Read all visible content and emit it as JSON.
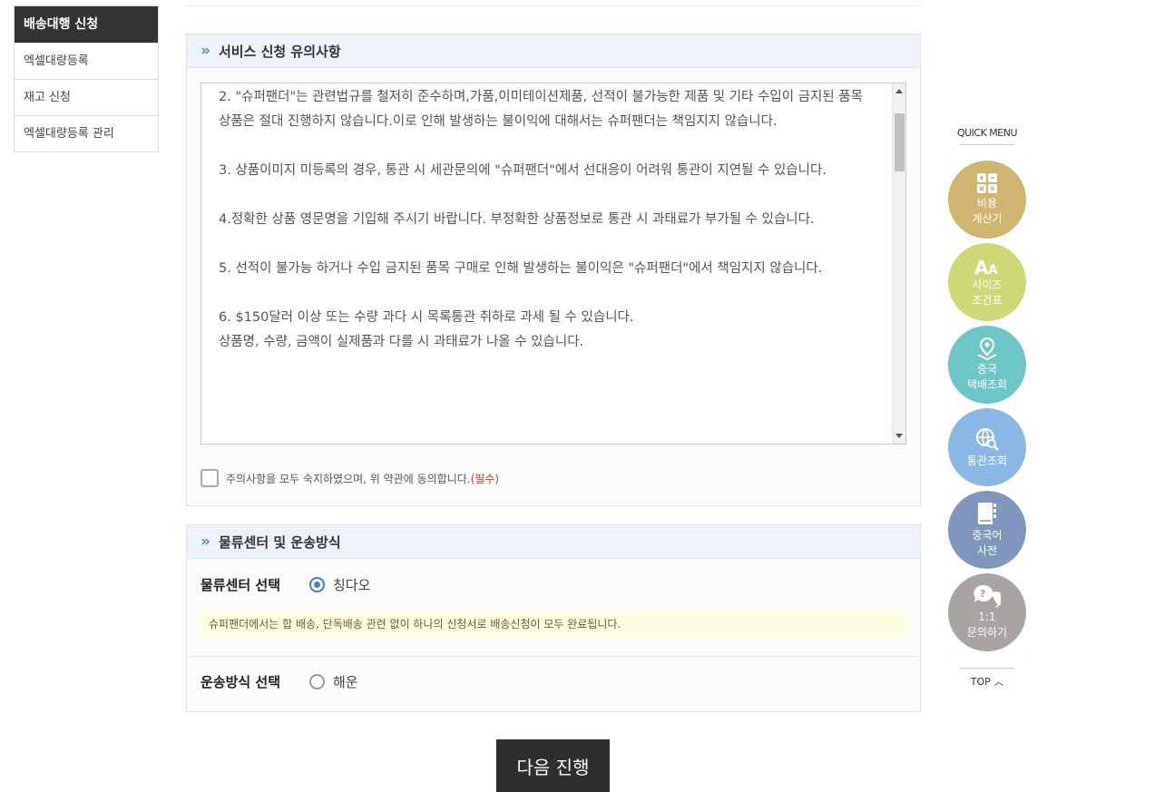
{
  "sidebar": {
    "header": "배송대행 신청",
    "items": [
      {
        "label": "엑셀대량등록"
      },
      {
        "label": "재고 신청"
      },
      {
        "label": "엑셀대량등록 관리"
      }
    ]
  },
  "notice": {
    "title": "서비스 신청 유의사항",
    "paragraphs": [
      "2. \"슈퍼팬더\"는 관련법규를 철저히 준수하며,가품,이미테이션제품, 선적이 불가능한 제품 및 기타 수입이 금지된 품목 상품은 절대 진행하지 않습니다.이로 인해 발생하는 불이익에 대해서는 슈퍼팬더는 책임지지 않습니다.",
      "3. 상품이미지 미등록의 경우, 통관 시 세관문의에 \"슈퍼팬더\"에서 선대응이 어려워 통관이 지연될 수 있습니다.",
      "4.정확한 상품 영문명을 기입해 주시기 바랍니다. 부정확한 상품정보로 통관 시 과태료가 부가될 수 있습니다.",
      "5. 선적이 불가능 하거나 수입 금지된 품목 구매로 인해 발생하는 불이익은 \"슈퍼팬더\"에서 책임지지 않습니다.",
      "6. $150달러 이상 또는 수량 과다 시 목록통관 취하로 과세 될 수 있습니다.\n상품명, 수량, 금액이 실제품과 다를 시 과태료가 나올 수 있습니다."
    ],
    "agree_text": "주의사항을 모두 숙지하였으며, 위 약관에 동의합니다.",
    "agree_required": "(필수)"
  },
  "logistics": {
    "title": "물류센터 및 운송방식",
    "center_label": "물류센터 선택",
    "center_option": "칭다오",
    "info": "슈퍼팬더에서는 합 배송, 단독배송 관련 없이 하나의 신청서로 배송신청이 모두 완료됩니다.",
    "shipping_label": "운송방식 선택",
    "shipping_option": "해운"
  },
  "next_button": "다음 진행",
  "quick_menu": {
    "title": "QUICK MENU",
    "items": [
      {
        "line1": "비용",
        "line2": "계산기",
        "color": "#cfb570",
        "icon": "calculator-icon"
      },
      {
        "line1": "사이즈",
        "line2": "조건표",
        "color": "#cdd876",
        "icon": "font-size-icon"
      },
      {
        "line1": "중국",
        "line2": "택배조회",
        "color": "#6ec6c6",
        "icon": "location-pin-icon"
      },
      {
        "line1": "통관조회",
        "line2": "",
        "color": "#8ab7e3",
        "icon": "globe-search-icon"
      },
      {
        "line1": "중국어",
        "line2": "사전",
        "color": "#7f97bd",
        "icon": "book-icon"
      },
      {
        "line1": "1:1",
        "line2": "문의하기",
        "color": "#a8a4a2",
        "icon": "question-chat-icon"
      }
    ],
    "top": "TOP"
  }
}
